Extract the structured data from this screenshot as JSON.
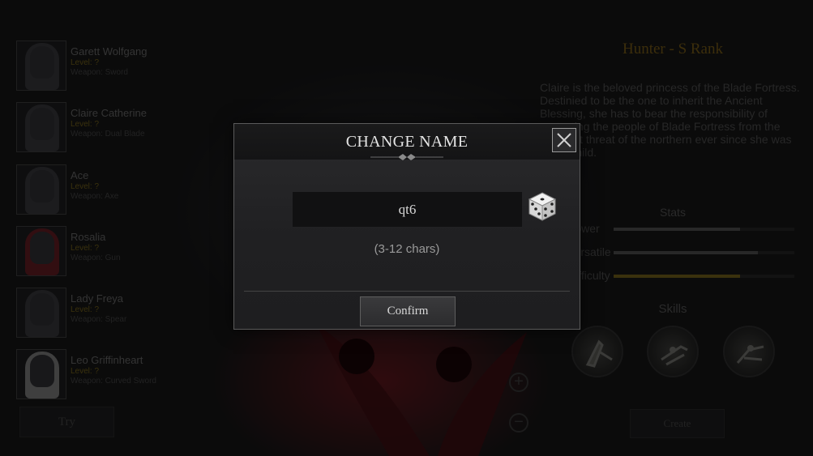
{
  "roster": [
    {
      "name": "Garett Wolfgang",
      "level": "Level: ?",
      "weapon": "Weapon: Sword"
    },
    {
      "name": "Claire Catherine",
      "level": "Level: ?",
      "weapon": "Weapon: Dual Blade"
    },
    {
      "name": "Ace",
      "level": "Level: ?",
      "weapon": "Weapon: Axe"
    },
    {
      "name": "Rosalia",
      "level": "Level: ?",
      "weapon": "Weapon: Gun"
    },
    {
      "name": "Lady Freya",
      "level": "Level: ?",
      "weapon": "Weapon: Spear"
    },
    {
      "name": "Leo Griffinheart",
      "level": "Level: ?",
      "weapon": "Weapon: Curved Sword"
    }
  ],
  "try_label": "Try",
  "create_label": "Create",
  "detail": {
    "class_title": "Hunter - S Rank",
    "bio": "Claire is the beloved princess of the Blade Fortress. Destinied to be the one to inherit the Ancient Blessing, she has to bear the responsibility of protecting the people of Blade Fortress from the constant threat of the northern ever since she was just a child.",
    "stats_title": "Stats",
    "stats": [
      {
        "label": "Power",
        "value": 0.7,
        "color": "#4a4a4a"
      },
      {
        "label": "Versatile",
        "value": 0.8,
        "color": "#4a4a4a"
      },
      {
        "label": "Difficulty",
        "value": 0.7,
        "color": "#6b5a18"
      }
    ],
    "skills_title": "Skills",
    "skills": [
      {
        "icon": "skill-slash-icon"
      },
      {
        "icon": "skill-dash-icon"
      },
      {
        "icon": "skill-strike-icon"
      }
    ]
  },
  "zoom": {
    "in": "+",
    "out": "−"
  },
  "modal": {
    "title": "CHANGE NAME",
    "name_value": "qt6",
    "hint": "(3-12 chars)",
    "confirm_label": "Confirm"
  }
}
